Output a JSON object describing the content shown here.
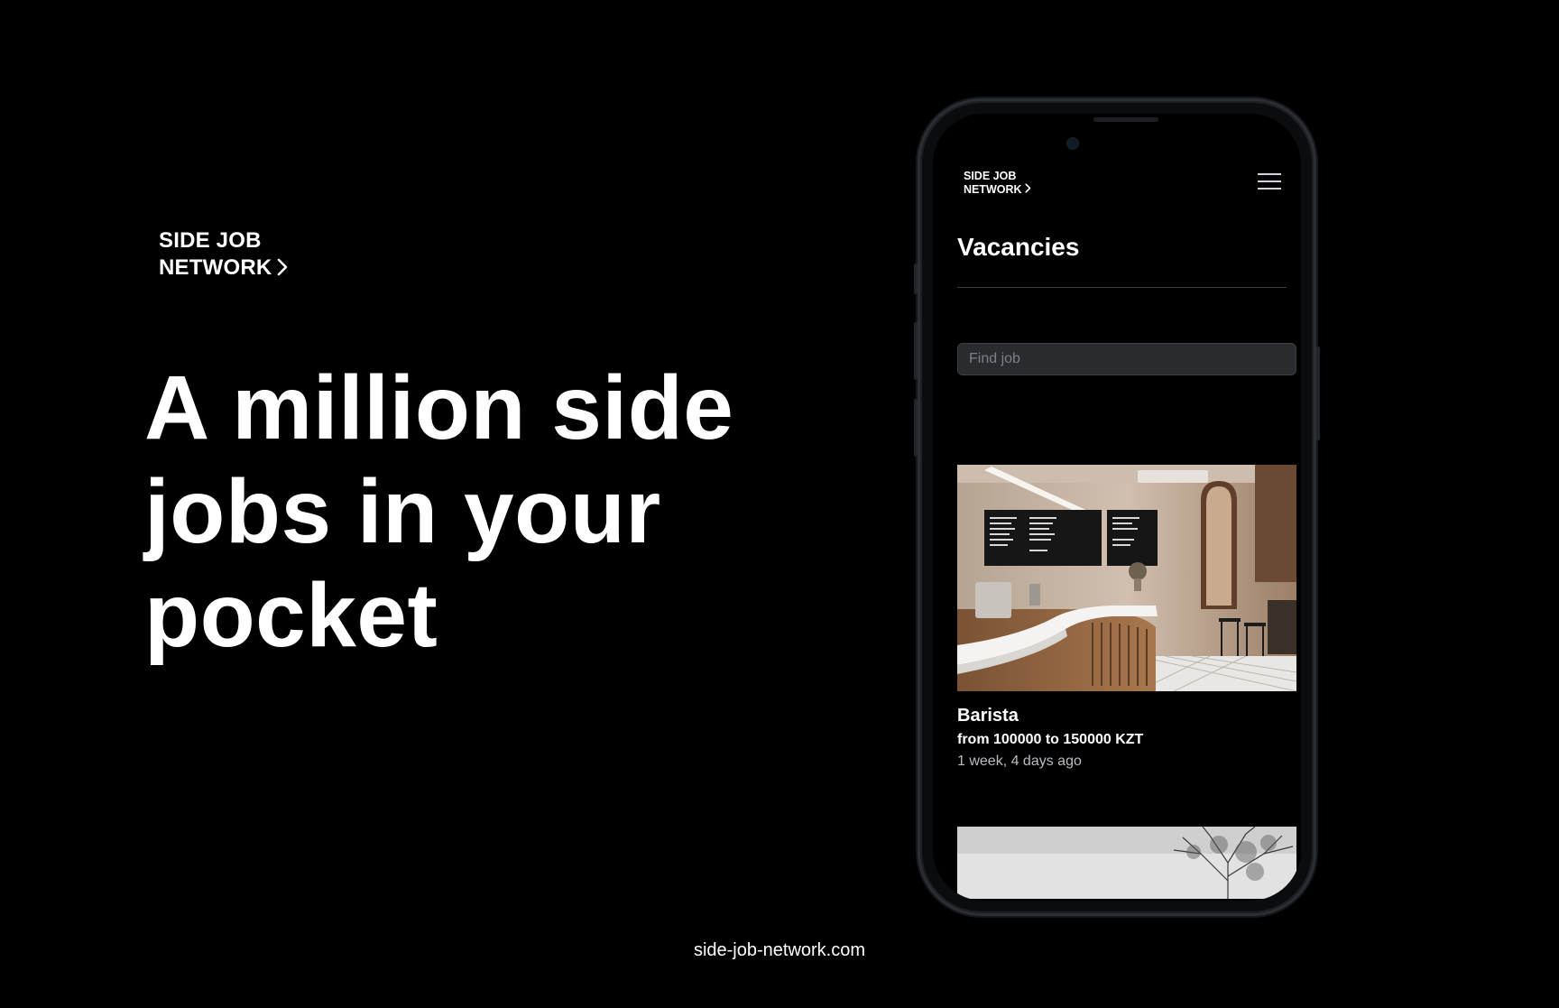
{
  "hero": {
    "brand_line1": "SIDE JOB",
    "brand_line2": "NETWORK",
    "headline": "A million side jobs in your pocket",
    "footer_link": "side-job-network.com"
  },
  "app": {
    "brand_line1": "SIDE JOB",
    "brand_line2": "NETWORK",
    "page_title": "Vacancies",
    "search": {
      "placeholder": "Find job",
      "value": ""
    },
    "vacancies": [
      {
        "title": "Barista",
        "salary": "from 100000 to 150000 KZT",
        "posted": "1 week, 4 days ago",
        "image": "cafe-interior"
      },
      {
        "image": "snowy-tree"
      }
    ]
  },
  "icons": {
    "brand_chevron": "chevron-right-icon",
    "menu": "hamburger-menu-icon"
  },
  "colors": {
    "background": "#000000",
    "text": "#ffffff",
    "muted_text": "#b9bcc0",
    "search_bg": "#2a2b2e"
  }
}
